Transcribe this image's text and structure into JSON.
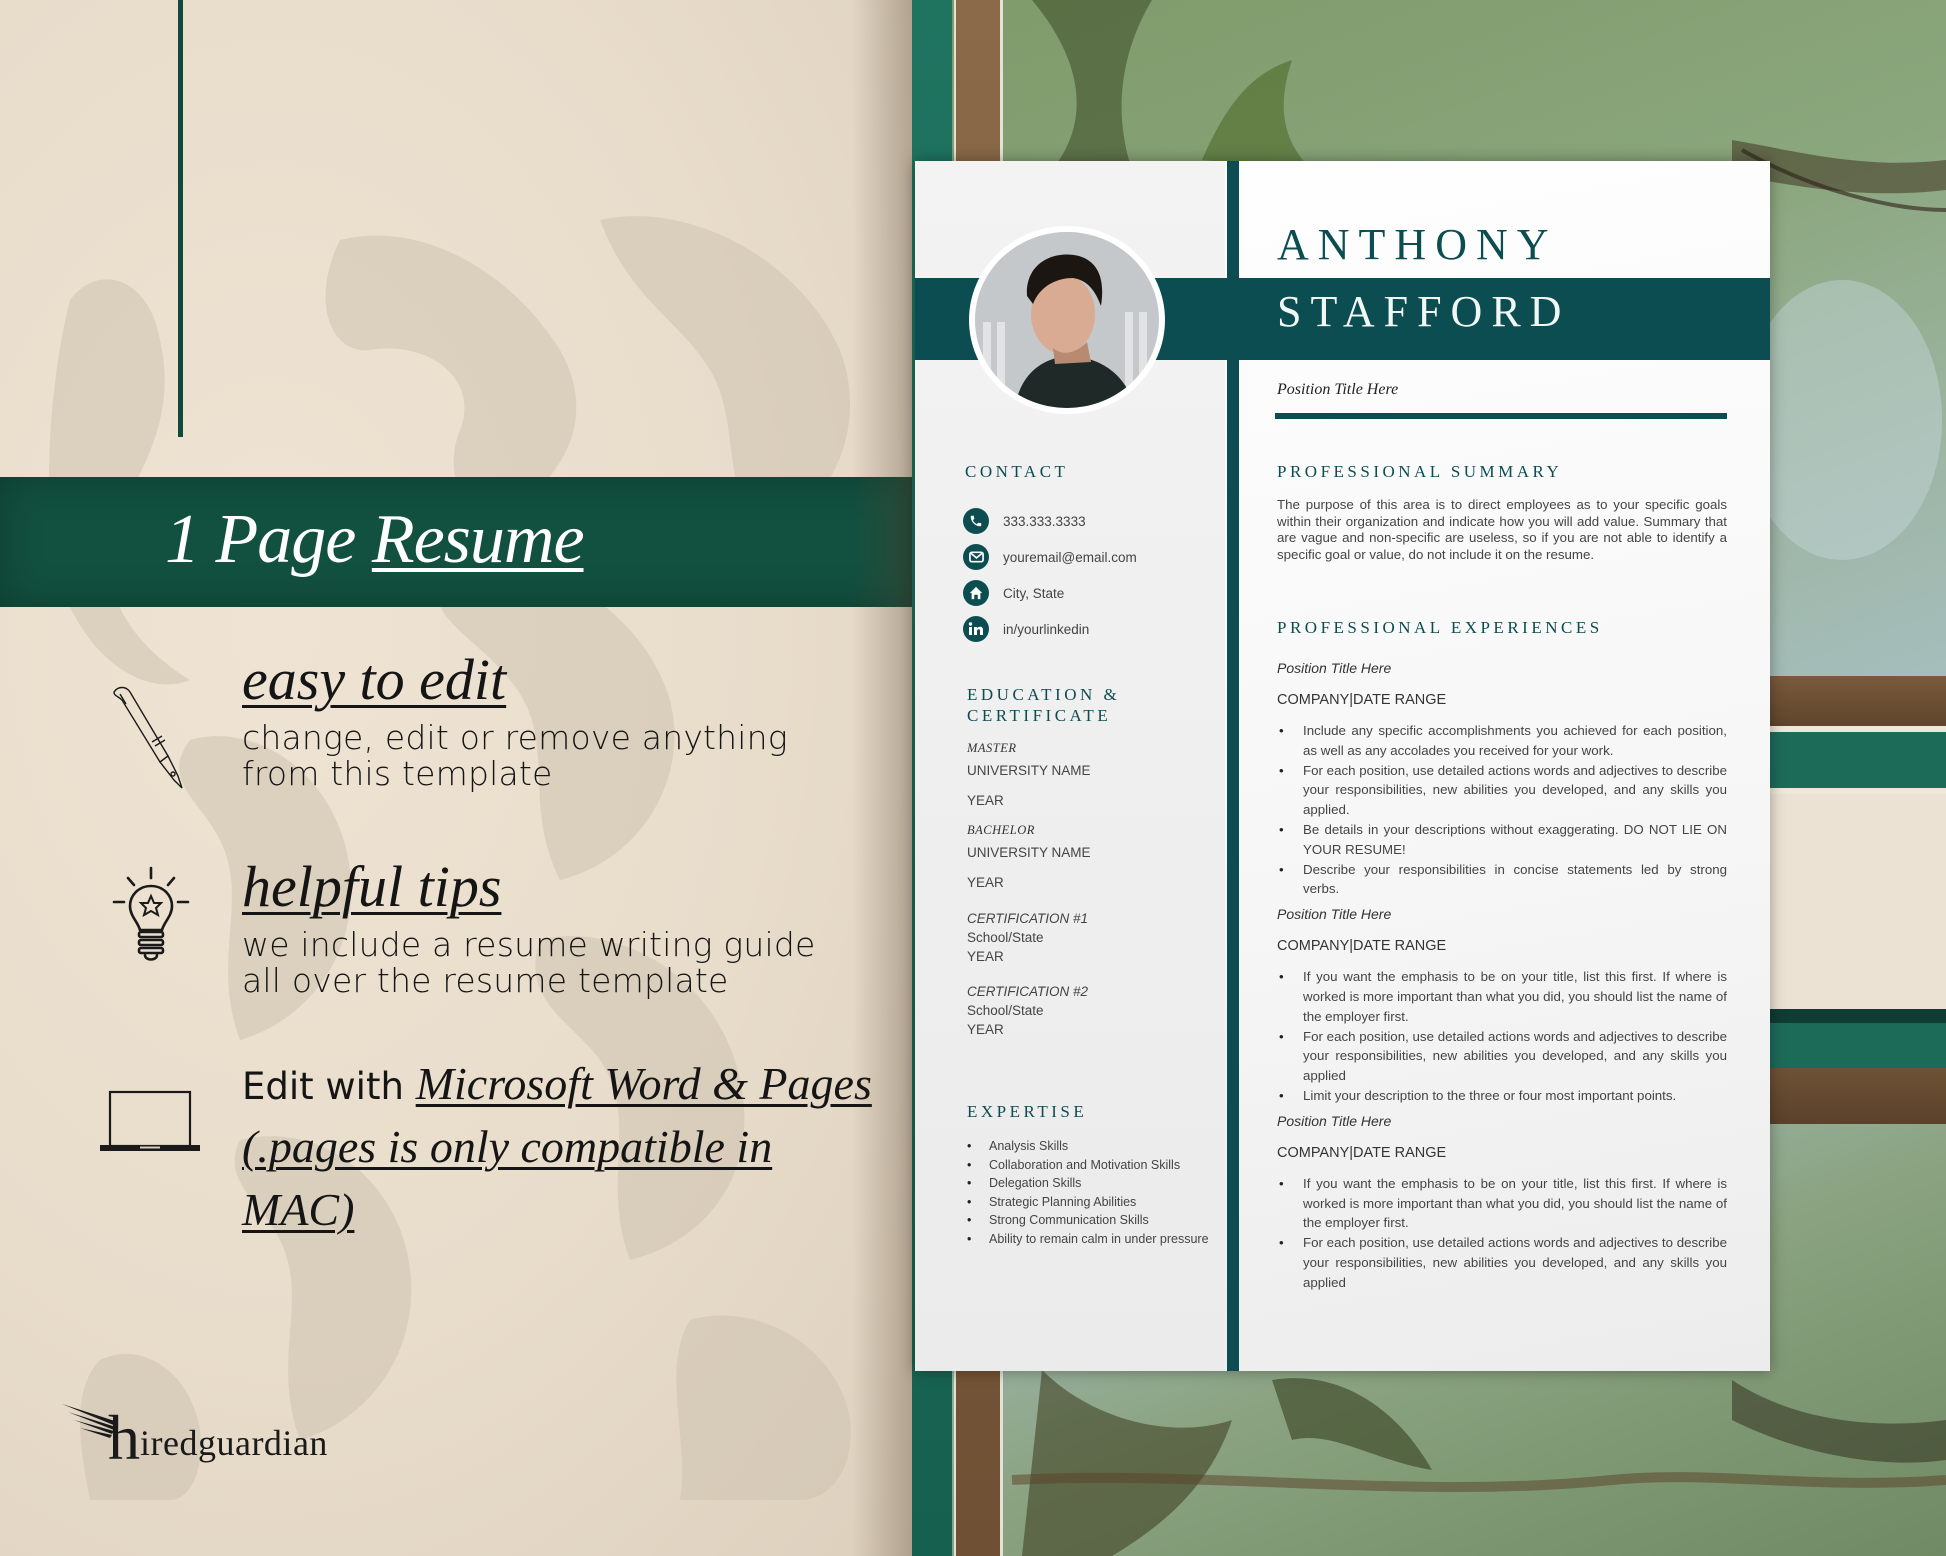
{
  "promo": {
    "banner": {
      "title_plain": "1 Page ",
      "title_underlined": "Resume",
      "color": "#12503f"
    },
    "features": [
      {
        "icon": "fountain-pen-icon",
        "title": "easy to edit",
        "description_line1": "change, edit or remove anything",
        "description_line2": "from this template"
      },
      {
        "icon": "lightbulb-star-icon",
        "title": "helpful tips",
        "description_line1": "we include a resume writing guide",
        "description_line2": "all over the resume template"
      },
      {
        "icon": "laptop-icon",
        "lead": "Edit with ",
        "title": "Microsoft Word & Pages (.pages is only compatible in MAC)"
      }
    ],
    "logo": {
      "initial": "h",
      "rest": "iredguardian"
    }
  },
  "resume": {
    "accent_color": "#0b4d51",
    "first_name": "ANTHONY",
    "last_name": "STAFFORD",
    "position_title": "Position Title Here",
    "contact": {
      "heading": "CONTACT",
      "items": [
        {
          "icon": "phone-icon",
          "text": "333.333.3333"
        },
        {
          "icon": "email-icon",
          "text": "youremail@email.com"
        },
        {
          "icon": "home-icon",
          "text": "City, State"
        },
        {
          "icon": "linkedin-icon",
          "text": "in/yourlinkedin"
        }
      ]
    },
    "education": {
      "heading_line1": "EDUCATION &",
      "heading_line2": "CERTIFICATE",
      "degrees": [
        {
          "degree": "MASTER",
          "school": "UNIVERSITY NAME",
          "year": "YEAR"
        },
        {
          "degree": "BACHELOR",
          "school": "UNIVERSITY NAME",
          "year": "YEAR"
        }
      ],
      "certifications": [
        {
          "name": "CERTIFICATION #1",
          "school": "School/State",
          "year": "YEAR"
        },
        {
          "name": "CERTIFICATION #2",
          "school": "School/State",
          "year": "YEAR"
        }
      ]
    },
    "expertise": {
      "heading": "EXPERTISE",
      "items": [
        "Analysis Skills",
        "Collaboration and Motivation Skills",
        "Delegation Skills",
        "Strategic Planning Abilities",
        "Strong Communication Skills",
        "Ability to remain calm in under pressure"
      ]
    },
    "summary": {
      "heading": "PROFESSIONAL SUMMARY",
      "text": "The purpose of this area is to direct employees as to your specific goals within their organization and indicate how you will add value. Summary that are vague and non-specific are useless, so if you are not able to identify a specific goal or value, do not include it on the resume."
    },
    "experience": {
      "heading": "PROFESSIONAL EXPERIENCES",
      "jobs": [
        {
          "title": "Position Title Here",
          "company": "COMPANY|DATE RANGE",
          "bullets": [
            "Include any specific accomplishments you achieved for each position, as well as any accolades you received for your work.",
            "For each position, use detailed actions words and adjectives to describe your responsibilities, new abilities you developed, and any skills you applied.",
            "Be details in your descriptions without exaggerating.  DO NOT LIE ON YOUR RESUME!",
            "Describe your responsibilities in concise statements led by strong verbs."
          ]
        },
        {
          "title": "Position Title Here",
          "company": "COMPANY|DATE RANGE",
          "bullets": [
            "If you want the emphasis to be on your title, list this first.  If where is worked is more important than what you did, you should list the name of the employer first.",
            "For each position, use detailed actions words and adjectives to describe your responsibilities, new abilities you developed, and any skills you applied",
            "Limit your description to the three or four most important points."
          ]
        },
        {
          "title": "Position Title Here",
          "company": "COMPANY|DATE RANGE",
          "bullets": [
            "If you want the emphasis to be on your title, list this first.  If where is worked is more important than what you did, you should list the name of the employer first.",
            "For each position, use detailed actions words and adjectives to describe your responsibilities, new abilities you developed, and any skills you applied"
          ]
        }
      ]
    }
  }
}
